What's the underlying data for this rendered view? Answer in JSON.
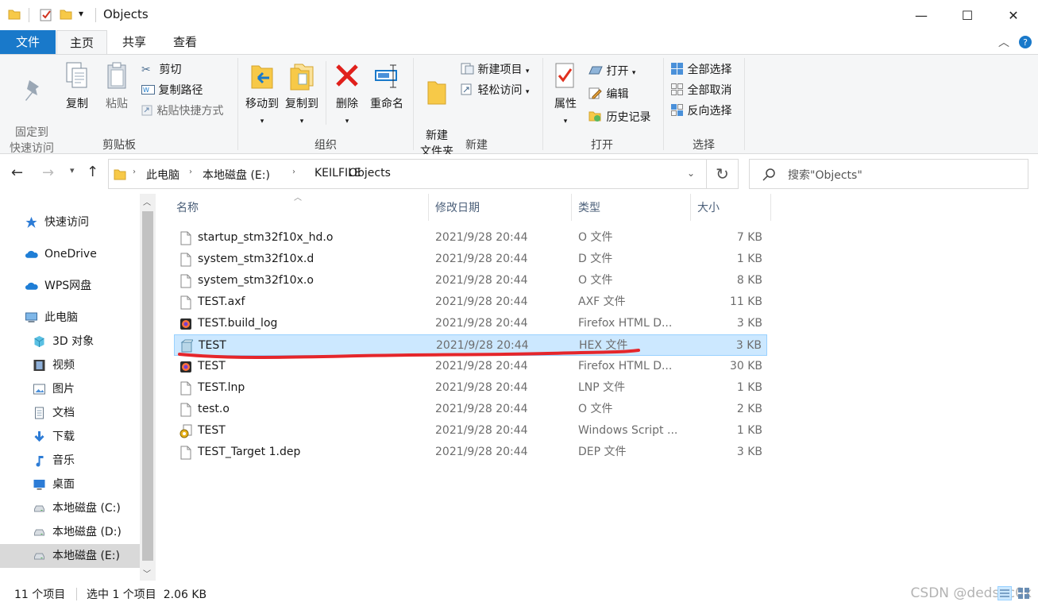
{
  "window": {
    "title": "Objects",
    "controls": {
      "minimize": "—",
      "maximize": "☐",
      "close": "✕"
    },
    "quick_access_dropdown": "▾"
  },
  "tabs": [
    "文件",
    "主页",
    "共享",
    "查看"
  ],
  "ribbon": {
    "clipboard": {
      "label": "剪贴板",
      "pin": "固定到\n快速访问",
      "copy": "复制",
      "paste": "粘贴",
      "cut": "剪切",
      "copy_path": "复制路径",
      "paste_shortcut": "粘贴快捷方式"
    },
    "organize": {
      "label": "组织",
      "move_to": "移动到",
      "copy_to": "复制到",
      "delete": "删除",
      "rename": "重命名"
    },
    "new": {
      "label": "新建",
      "new_folder": "新建\n文件夹",
      "new_item": "新建项目",
      "easy_access": "轻松访问"
    },
    "open": {
      "label": "打开",
      "properties": "属性",
      "open": "打开",
      "edit": "编辑",
      "history": "历史记录"
    },
    "select": {
      "label": "选择",
      "select_all": "全部选择",
      "select_none": "全部取消",
      "invert": "反向选择"
    }
  },
  "address": {
    "crumbs": [
      "此电脑",
      "本地磁盘 (E:)",
      "KEILFILE",
      "Objects"
    ],
    "search_placeholder": "搜索\"Objects\""
  },
  "nav": [
    {
      "label": "快速访问",
      "icon": "star-icon",
      "indent": 1
    },
    {
      "label": "OneDrive",
      "icon": "cloud-icon",
      "indent": 1
    },
    {
      "label": "WPS网盘",
      "icon": "cloud-icon",
      "indent": 1
    },
    {
      "label": "此电脑",
      "icon": "computer-icon",
      "indent": 1
    },
    {
      "label": "3D 对象",
      "icon": "cube-icon",
      "indent": 2
    },
    {
      "label": "视频",
      "icon": "film-icon",
      "indent": 2
    },
    {
      "label": "图片",
      "icon": "picture-icon",
      "indent": 2
    },
    {
      "label": "文档",
      "icon": "document-icon",
      "indent": 2
    },
    {
      "label": "下载",
      "icon": "download-icon",
      "indent": 2
    },
    {
      "label": "音乐",
      "icon": "music-icon",
      "indent": 2
    },
    {
      "label": "桌面",
      "icon": "desktop-icon",
      "indent": 2
    },
    {
      "label": "本地磁盘 (C:)",
      "icon": "drive-icon",
      "indent": 2
    },
    {
      "label": "本地磁盘 (D:)",
      "icon": "drive-icon",
      "indent": 2
    },
    {
      "label": "本地磁盘 (E:)",
      "icon": "drive-icon",
      "indent": 2,
      "selected": true
    }
  ],
  "columns": {
    "name": "名称",
    "date": "修改日期",
    "type": "类型",
    "size": "大小"
  },
  "files": [
    {
      "name": "startup_stm32f10x_hd.o",
      "date": "2021/9/28 20:44",
      "type": "O 文件",
      "size": "7 KB",
      "icon": "file-icon"
    },
    {
      "name": "system_stm32f10x.d",
      "date": "2021/9/28 20:44",
      "type": "D 文件",
      "size": "1 KB",
      "icon": "file-icon"
    },
    {
      "name": "system_stm32f10x.o",
      "date": "2021/9/28 20:44",
      "type": "O 文件",
      "size": "8 KB",
      "icon": "file-icon"
    },
    {
      "name": "TEST.axf",
      "date": "2021/9/28 20:44",
      "type": "AXF 文件",
      "size": "11 KB",
      "icon": "file-icon"
    },
    {
      "name": "TEST.build_log",
      "date": "2021/9/28 20:44",
      "type": "Firefox HTML D...",
      "size": "3 KB",
      "icon": "firefox-icon"
    },
    {
      "name": "TEST",
      "date": "2021/9/28 20:44",
      "type": "HEX 文件",
      "size": "3 KB",
      "icon": "hex-file-icon",
      "selected": true
    },
    {
      "name": "TEST",
      "date": "2021/9/28 20:44",
      "type": "Firefox HTML D...",
      "size": "30 KB",
      "icon": "firefox-icon"
    },
    {
      "name": "TEST.lnp",
      "date": "2021/9/28 20:44",
      "type": "LNP 文件",
      "size": "1 KB",
      "icon": "file-icon"
    },
    {
      "name": "test.o",
      "date": "2021/9/28 20:44",
      "type": "O 文件",
      "size": "2 KB",
      "icon": "file-icon"
    },
    {
      "name": "TEST",
      "date": "2021/9/28 20:44",
      "type": "Windows Script ...",
      "size": "1 KB",
      "icon": "script-icon"
    },
    {
      "name": "TEST_Target 1.dep",
      "date": "2021/9/28 20:44",
      "type": "DEP 文件",
      "size": "3 KB",
      "icon": "file-icon"
    }
  ],
  "status": {
    "count": "11 个项目",
    "selection": "选中 1 个项目  2.06 KB",
    "watermark": "CSDN @dedsec0x"
  },
  "colors": {
    "accent": "#1979ca",
    "selection": "#cce8ff",
    "annotation": "#e5262b"
  }
}
